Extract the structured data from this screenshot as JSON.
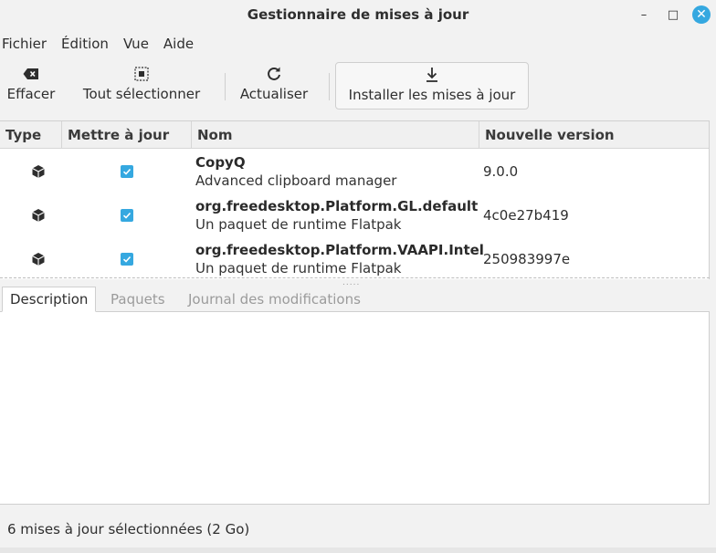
{
  "window": {
    "title": "Gestionnaire de mises à jour",
    "controls": {
      "minimize": "–",
      "maximize": "□",
      "close": "✕"
    },
    "accent_color": "#35a8e0"
  },
  "menubar": {
    "items": [
      {
        "label": "Fichier"
      },
      {
        "label": "Édition"
      },
      {
        "label": "Vue"
      },
      {
        "label": "Aide"
      }
    ]
  },
  "toolbar": {
    "clear": {
      "label": "Effacer",
      "icon": "backspace-icon"
    },
    "select_all": {
      "label": "Tout sélectionner",
      "icon": "select-all-icon"
    },
    "refresh": {
      "label": "Actualiser",
      "icon": "refresh-icon"
    },
    "install": {
      "label": "Installer les mises à jour",
      "icon": "download-icon"
    }
  },
  "updates_table": {
    "columns": {
      "type": "Type",
      "update": "Mettre à jour",
      "name": "Nom",
      "new_version": "Nouvelle version"
    },
    "rows": [
      {
        "type_icon": "package-icon",
        "checked": true,
        "name": "CopyQ",
        "description": "Advanced clipboard manager",
        "version": "9.0.0"
      },
      {
        "type_icon": "package-icon",
        "checked": true,
        "name": "org.freedesktop.Platform.GL.default",
        "description": "Un paquet de runtime Flatpak",
        "version": "4c0e27b419"
      },
      {
        "type_icon": "package-icon",
        "checked": true,
        "name": "org.freedesktop.Platform.VAAPI.Intel",
        "description": "Un paquet de runtime Flatpak",
        "version": "250983997e"
      }
    ]
  },
  "details_tabs": {
    "items": [
      {
        "label": "Description",
        "active": true
      },
      {
        "label": "Paquets",
        "active": false
      },
      {
        "label": "Journal des modifications",
        "active": false
      }
    ],
    "content": ""
  },
  "statusbar": {
    "text": "6 mises à jour sélectionnées (2 Go)"
  }
}
